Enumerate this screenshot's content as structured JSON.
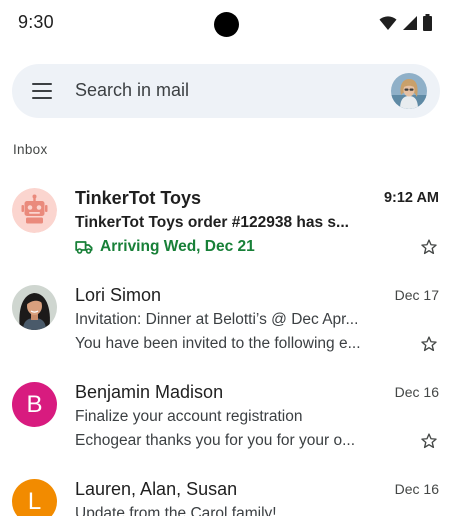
{
  "status_bar": {
    "time": "9:30",
    "icons": [
      "wifi-icon",
      "signal-icon",
      "battery-icon"
    ]
  },
  "search": {
    "placeholder": "Search in mail"
  },
  "folder": {
    "label": "Inbox"
  },
  "colors": {
    "search_bg": "#eef2f7",
    "arriving_green": "#188038",
    "avatar_magenta": "#d81b7f",
    "avatar_orange": "#f28b00",
    "robot_bg": "#fbd5cf",
    "robot_fg": "#ea8a7c"
  },
  "emails": [
    {
      "sender": "TinkerTot Toys",
      "date": "9:12 AM",
      "subject": "TinkerTot Toys order #122938 has s...",
      "status": "Arriving Wed, Dec 21",
      "unread": true,
      "avatar_icon": "robot-icon",
      "status_icon": "truck-icon"
    },
    {
      "sender": "Lori Simon",
      "date": "Dec 17",
      "subject": "Invitation: Dinner at Belotti’s @ Dec Apr...",
      "snippet": "You have been invited to the following e...",
      "unread": false,
      "avatar_icon": "photo-avatar"
    },
    {
      "sender": "Benjamin Madison",
      "date": "Dec 16",
      "subject": "Finalize your account registration",
      "snippet": "Echogear thanks you for you for your o...",
      "unread": false,
      "avatar_letter": "B"
    },
    {
      "sender": "Lauren, Alan, Susan",
      "date": "Dec 16",
      "subject": "Update from the Carol family!",
      "snippet": "",
      "unread": false,
      "avatar_letter": "L"
    }
  ]
}
